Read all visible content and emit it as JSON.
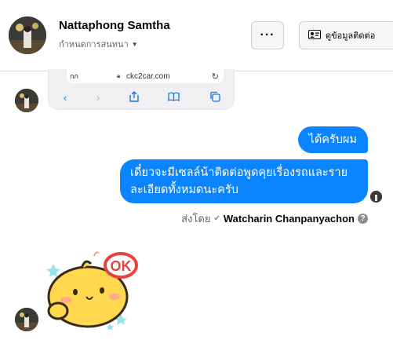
{
  "header": {
    "name": "Nattaphong Samtha",
    "subtitle": "กำหนดการสนทนา",
    "more_label": "···",
    "info_label": "ดูข้อมูลติดต่อ"
  },
  "screenshot": {
    "address_prefix": "กก",
    "host": "ckc2car.com"
  },
  "messages": [
    {
      "from": "me",
      "text": "ได้ครับผม"
    },
    {
      "from": "me",
      "text": "เดี๋ยวจะมีเซลล์น้าติดต่อพูดคุยเรื่องรถและรายละเอียดทั้งหมดนะครับ"
    }
  ],
  "sent_by": {
    "prefix": "ส่งโดย",
    "name": "Watcharin Chanpanyachon",
    "help": "?"
  },
  "sticker": {
    "text": "OK"
  },
  "colors": {
    "bubble": "#0b84ff",
    "accent": "#1a73e8"
  }
}
